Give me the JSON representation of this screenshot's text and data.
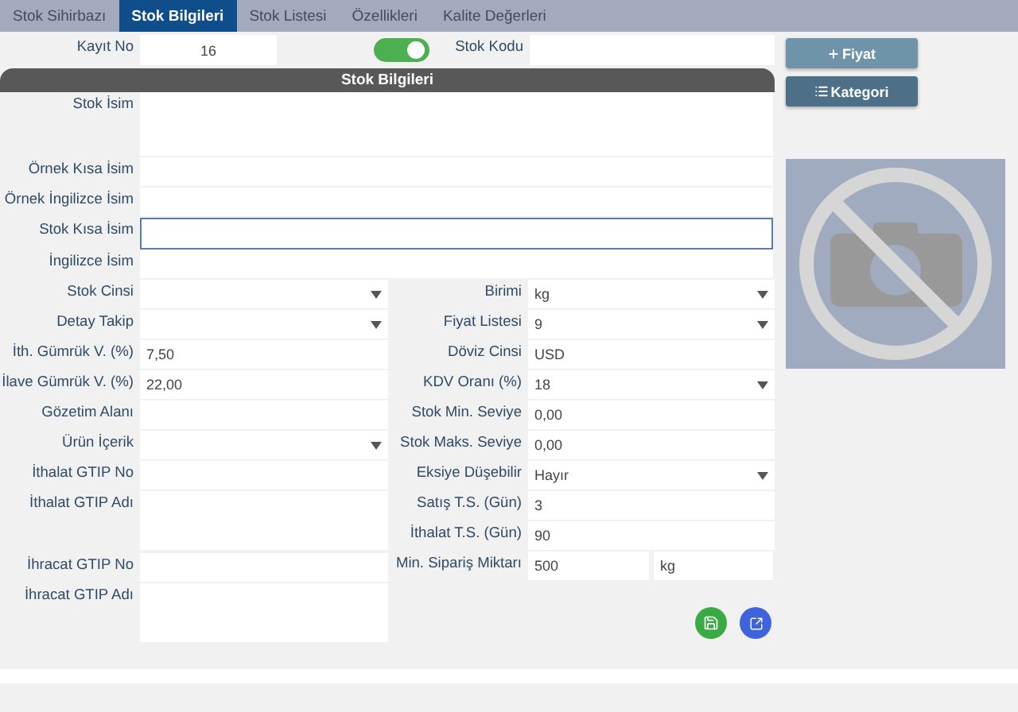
{
  "tabs": [
    {
      "label": "Stok Sihirbazı",
      "selected": false
    },
    {
      "label": "Stok Bilgileri",
      "selected": true
    },
    {
      "label": "Stok Listesi",
      "selected": false
    },
    {
      "label": "Özellikleri",
      "selected": false
    },
    {
      "label": "Kalite Değerleri",
      "selected": false
    }
  ],
  "record_no": {
    "label": "Kayıt No",
    "value": "16"
  },
  "active_toggle": {
    "on": true
  },
  "stock_code": {
    "label": "Stok Kodu"
  },
  "section_title": "Stok Bilgileri",
  "name_fields": [
    {
      "label": "Stok İsim",
      "kind": "textarea"
    },
    {
      "label": "Örnek Kısa İsim",
      "kind": "text"
    },
    {
      "label": "Örnek İngilizce İsim",
      "kind": "text"
    },
    {
      "label": "Stok Kısa İsim",
      "kind": "text",
      "focused": true
    },
    {
      "label": "İngilizce İsim",
      "kind": "text"
    }
  ],
  "left_fields": [
    {
      "label": "Stok Cinsi",
      "kind": "select"
    },
    {
      "label": "Detay Takip",
      "kind": "select"
    },
    {
      "label": "İth. Gümrük V. (%)",
      "kind": "text",
      "value": "7,50"
    },
    {
      "label": "İlave Gümrük V. (%)",
      "kind": "text",
      "value": "22,00"
    },
    {
      "label": "Gözetim Alanı",
      "kind": "text"
    },
    {
      "label": "Ürün İçerik",
      "kind": "select"
    },
    {
      "label": "İthalat GTIP No",
      "kind": "text"
    },
    {
      "label": "İthalat GTIP Adı",
      "kind": "textarea"
    },
    {
      "label": "İhracat GTIP No",
      "kind": "text"
    },
    {
      "label": "İhracat GTIP Adı",
      "kind": "textarea"
    }
  ],
  "right_fields": [
    {
      "label": "Birimi",
      "kind": "select",
      "value": "kg"
    },
    {
      "label": "Fiyat Listesi",
      "kind": "select",
      "value": "9"
    },
    {
      "label": "Döviz Cinsi",
      "kind": "text",
      "value": "USD"
    },
    {
      "label": "KDV Oranı (%)",
      "kind": "select",
      "value": "18"
    },
    {
      "label": "Stok Min. Seviye",
      "kind": "text",
      "value": "0,00"
    },
    {
      "label": "Stok Maks. Seviye",
      "kind": "text",
      "value": "0,00"
    },
    {
      "label": "Eksiye Düşebilir",
      "kind": "select",
      "value": "Hayır"
    },
    {
      "label": "Satış T.S. (Gün)",
      "kind": "text",
      "value": "3"
    },
    {
      "label": "İthalat T.S. (Gün)",
      "kind": "text",
      "value": "90"
    },
    {
      "label": "Min. Sipariş Miktarı",
      "kind": "quantity",
      "value": "500",
      "unit": "kg"
    }
  ],
  "side_buttons": [
    {
      "label": "Fiyat",
      "kind": "add"
    },
    {
      "label": "Kategori",
      "kind": "list"
    }
  ]
}
